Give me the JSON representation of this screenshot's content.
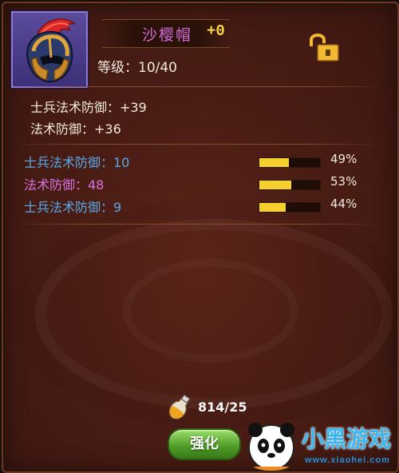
{
  "item": {
    "name": "沙樱帽",
    "enhance": "+0",
    "level_text": "等级：10/40",
    "icon": "helmet-icon",
    "lock_icon": "unlocked-padlock-icon"
  },
  "base_stats": [
    "士兵法术防御：+39",
    "法术防御：+36"
  ],
  "extra_stats": [
    {
      "label": "士兵法术防御：10",
      "color": "#5aa7e8",
      "fill": 0.49,
      "pct": "49%"
    },
    {
      "label": "法术防御：48",
      "color": "#d873e0",
      "fill": 0.53,
      "pct": "53%"
    },
    {
      "label": "士兵法术防御：9",
      "color": "#5aa7e8",
      "fill": 0.44,
      "pct": "44%"
    }
  ],
  "material": {
    "icon": "potion-icon",
    "count": "814/25"
  },
  "button": {
    "label": "强化"
  },
  "watermark": {
    "title": "小黑游戏",
    "url": "www.xiaohei.com"
  },
  "colors": {
    "stat_bar": "#f6d12e",
    "button_green": "#4d9a25",
    "name_purple": "#d36bd8"
  }
}
